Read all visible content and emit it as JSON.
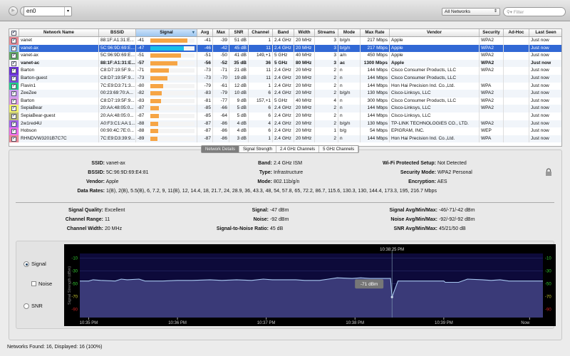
{
  "toolbar": {
    "interface": "en0",
    "network_filter": "All Networks",
    "filter_placeholder": "Filter"
  },
  "table": {
    "columns": [
      "Network Name",
      "BSSID",
      "Signal",
      "Avg",
      "Max",
      "SNR",
      "Channel",
      "Band",
      "Width",
      "Streams",
      "Mode",
      "Max Rate",
      "Vendor",
      "Security",
      "Ad-Hoc",
      "Last Seen"
    ],
    "rows": [
      {
        "color": "#e88a94",
        "name": "vanet",
        "bssid": "88:1F:A1:31:E...",
        "signal": -41,
        "avg": -41,
        "max": -39,
        "snr": "51 dB",
        "channel": "1",
        "band": "2.4 GHz",
        "width": "20 MHz",
        "streams": "3",
        "mode": "b/g/n",
        "rate": "217 Mbps",
        "vendor": "Apple",
        "security": "WPA2",
        "adhoc": "",
        "seen": "Just now"
      },
      {
        "color": "#8fc0f0",
        "name": "vanet-ax",
        "bssid": "5C:96:9D:69:E...",
        "signal": -47,
        "avg": -46,
        "max": -42,
        "snr": "45 dB",
        "channel": "11",
        "band": "2.4 GHz",
        "width": "20 MHz",
        "streams": "3",
        "mode": "b/g/n",
        "rate": "217 Mbps",
        "vendor": "Apple",
        "security": "WPA2",
        "adhoc": "",
        "seen": "Just now",
        "selected": true
      },
      {
        "color": "#62a862",
        "name": "vanet-ax",
        "bssid": "5C:96:9D:69:E...",
        "signal": -51,
        "avg": -51,
        "max": -50,
        "snr": "41 dB",
        "channel": "149,+1",
        "band": "5 GHz",
        "width": "40 MHz",
        "streams": "3",
        "mode": "a/n",
        "rate": "450 Mbps",
        "vendor": "Apple",
        "security": "WPA2",
        "adhoc": "",
        "seen": "Just now"
      },
      {
        "color": "#f4f4fa",
        "name": "vanet-ac",
        "bssid": "88:1F:A1:31:E...",
        "signal": -57,
        "avg": -56,
        "max": -52,
        "snr": "35 dB",
        "channel": "36",
        "band": "5 GHz",
        "width": "80 MHz",
        "streams": "3",
        "mode": "ac",
        "rate": "1300 Mbps",
        "vendor": "Apple",
        "security": "WPA2",
        "adhoc": "",
        "seen": "Just now",
        "bold": true
      },
      {
        "color": "#6a2ed8",
        "name": "Barton",
        "bssid": "C8:D7:19:5F:9...",
        "signal": -71,
        "avg": -73,
        "max": -71,
        "snr": "21 dB",
        "channel": "11",
        "band": "2.4 GHz",
        "width": "20 MHz",
        "streams": "2",
        "mode": "n",
        "rate": "144 Mbps",
        "vendor": "Cisco Consumer Products, LLC",
        "security": "WPA2",
        "adhoc": "",
        "seen": "Just now"
      },
      {
        "color": "#7a4ee0",
        "name": "Barton-guest",
        "bssid": "C8:D7:19:5F:9...",
        "signal": -73,
        "avg": -73,
        "max": -70,
        "snr": "19 dB",
        "channel": "11",
        "band": "2.4 GHz",
        "width": "20 MHz",
        "streams": "2",
        "mode": "n",
        "rate": "144 Mbps",
        "vendor": "Cisco Consumer Products, LLC",
        "security": "",
        "adhoc": "",
        "seen": "Just now"
      },
      {
        "color": "#22d08a",
        "name": "Flavin1",
        "bssid": "7C:E9:D3:71:3...",
        "signal": -80,
        "avg": -79,
        "max": -61,
        "snr": "12 dB",
        "channel": "1",
        "band": "2.4 GHz",
        "width": "20 MHz",
        "streams": "2",
        "mode": "n",
        "rate": "144 Mbps",
        "vendor": "Hon Hai Precision Ind. Co.,Ltd.",
        "security": "WPA",
        "adhoc": "",
        "seen": "Just now"
      },
      {
        "color": "#c8a0ee",
        "name": "ZeeZee",
        "bssid": "00:23:69:70:A...",
        "signal": -82,
        "avg": -83,
        "max": -79,
        "snr": "10 dB",
        "channel": "6",
        "band": "2.4 GHz",
        "width": "20 MHz",
        "streams": "2",
        "mode": "b/g/n",
        "rate": "130 Mbps",
        "vendor": "Cisco-Linksys, LLC",
        "security": "WPA2",
        "adhoc": "",
        "seen": "Just now"
      },
      {
        "color": "#e09ae8",
        "name": "Barton",
        "bssid": "C8:D7:19:5F:9...",
        "signal": -83,
        "avg": -81,
        "max": -77,
        "snr": "9 dB",
        "channel": "157,+1",
        "band": "5 GHz",
        "width": "40 MHz",
        "streams": "4",
        "mode": "n",
        "rate": "300 Mbps",
        "vendor": "Cisco Consumer Products, LLC",
        "security": "WPA2",
        "adhoc": "",
        "seen": "Just now"
      },
      {
        "color": "#eef070",
        "name": "SepiaBear",
        "bssid": "20:AA:48:05:0...",
        "signal": -87,
        "avg": -85,
        "max": -66,
        "snr": "5 dB",
        "channel": "6",
        "band": "2.4 GHz",
        "width": "20 MHz",
        "streams": "2",
        "mode": "n",
        "rate": "144 Mbps",
        "vendor": "Cisco-Linksys, LLC",
        "security": "WPA2",
        "adhoc": "",
        "seen": "Just now"
      },
      {
        "color": "#b8ba78",
        "name": "SepiaBear-guest",
        "bssid": "20:AA:48:05:0...",
        "signal": -87,
        "avg": -85,
        "max": -64,
        "snr": "5 dB",
        "channel": "6",
        "band": "2.4 GHz",
        "width": "20 MHz",
        "streams": "2",
        "mode": "n",
        "rate": "144 Mbps",
        "vendor": "Cisco-Linksys, LLC",
        "security": "",
        "adhoc": "",
        "seen": "Just now"
      },
      {
        "color": "#a266ee",
        "name": "2w1red4U",
        "bssid": "A0:F3:C1:AA:1...",
        "signal": -88,
        "avg": -87,
        "max": -86,
        "snr": "4 dB",
        "channel": "4",
        "band": "2.4 GHz",
        "width": "20 MHz",
        "streams": "2",
        "mode": "b/g/n",
        "rate": "130 Mbps",
        "vendor": "TP-LINK TECHNOLOGIES CO., LTD.",
        "security": "WPA2",
        "adhoc": "",
        "seen": "Just now"
      },
      {
        "color": "#ee70ea",
        "name": "Hobson",
        "bssid": "00:90:4C:7E:0...",
        "signal": -88,
        "avg": -87,
        "max": -86,
        "snr": "4 dB",
        "channel": "6",
        "band": "2.4 GHz",
        "width": "20 MHz",
        "streams": "1",
        "mode": "b/g",
        "rate": "54 Mbps",
        "vendor": "EPIGRAM, INC.",
        "security": "WEP",
        "adhoc": "",
        "seen": "Just now"
      },
      {
        "color": "#e88a94",
        "name": "RHNDVW3201B7C7C",
        "bssid": "7C:E9:D3:39:9...",
        "signal": -89,
        "avg": -87,
        "max": -86,
        "snr": "3 dB",
        "channel": "1",
        "band": "2.4 GHz",
        "width": "20 MHz",
        "streams": "2",
        "mode": "n",
        "rate": "144 Mbps",
        "vendor": "Hon Hai Precision Ind. Co.,Ltd.",
        "security": "WPA",
        "adhoc": "",
        "seen": "Just now"
      }
    ]
  },
  "tabs": [
    "Network Details",
    "Signal Strength",
    "2.4 GHz Channels",
    "5 GHz Channels"
  ],
  "details": {
    "ssid": {
      "label": "SSID:",
      "value": "vanet-ax"
    },
    "bssid": {
      "label": "BSSID:",
      "value": "5C:96:9D:69:E4:81"
    },
    "vendor": {
      "label": "Vendor:",
      "value": "Apple"
    },
    "band": {
      "label": "Band:",
      "value": "2.4 GHz ISM"
    },
    "type": {
      "label": "Type:",
      "value": "Infrastructure"
    },
    "mode": {
      "label": "Mode:",
      "value": "802.11b/g/n"
    },
    "wps": {
      "label": "Wi-Fi Protected Setup:",
      "value": "Not Detected"
    },
    "security": {
      "label": "Security Mode:",
      "value": "WPA2 Personal"
    },
    "encryption": {
      "label": "Encryption:",
      "value": "AES"
    },
    "rates": {
      "label": "Data Rates:",
      "value": "1(B), 2(B), 5.5(B), 6, 7.2, 9, 11(B), 12, 14.4, 18, 21.7, 24, 28.9, 36, 43.3, 48, 54, 57.8, 65, 72.2, 86.7, 115.6, 130.3, 130, 144.4, 173.3, 195, 216.7 Mbps"
    },
    "quality": {
      "label": "Signal Quality:",
      "value": "Excellent"
    },
    "range": {
      "label": "Channel Range:",
      "value": "11"
    },
    "chwidth": {
      "label": "Channel Width:",
      "value": "20 MHz"
    },
    "signal": {
      "label": "Signal:",
      "value": "-47 dBm"
    },
    "noise": {
      "label": "Noise:",
      "value": "-92 dBm"
    },
    "snr": {
      "label": "Signal-to-Noise Ratio:",
      "value": "45 dB"
    },
    "sigamm": {
      "label": "Signal Avg/Min/Max:",
      "value": "-46/-71/-42 dBm"
    },
    "noiseamm": {
      "label": "Noise Avg/Min/Max:",
      "value": "-92/-92/-92 dBm"
    },
    "snramm": {
      "label": "SNR Avg/Min/Max:",
      "value": "45/21/50 dB"
    }
  },
  "graph_options": {
    "signal": "Signal",
    "noise": "Noise",
    "snr": "SNR"
  },
  "chart_data": {
    "type": "line",
    "ylabel": "Signal Strength (dBm)",
    "ylim": [
      -103,
      -3
    ],
    "yticks": [
      "-10",
      "-30",
      "-50",
      "-70",
      "-90"
    ],
    "ytick_values": [
      -10,
      -30,
      -50,
      -70,
      -90
    ],
    "xlim_seconds": [
      -6,
      307
    ],
    "xticks": [
      "10:35 PM",
      "10:36 PM",
      "10:37 PM",
      "10:38 PM",
      "10:39 PM",
      "Now"
    ],
    "xtick_seconds": [
      0,
      60,
      120,
      180,
      240,
      298
    ],
    "cursor_label": "10:38:25 PM",
    "cursor_seconds": 205,
    "tooltip": "-71 dBm",
    "series": [
      {
        "name": "Signal",
        "points": [
          [
            -6,
            -46
          ],
          [
            0,
            -46
          ],
          [
            3,
            -44
          ],
          [
            8,
            -45
          ],
          [
            18,
            -46
          ],
          [
            22,
            -43
          ],
          [
            26,
            -44
          ],
          [
            34,
            -43
          ],
          [
            38,
            -46
          ],
          [
            50,
            -46
          ],
          [
            60,
            -45
          ],
          [
            70,
            -45
          ],
          [
            82,
            -44
          ],
          [
            90,
            -45
          ],
          [
            100,
            -44
          ],
          [
            110,
            -45
          ],
          [
            118,
            -43
          ],
          [
            124,
            -44
          ],
          [
            140,
            -44
          ],
          [
            146,
            -45
          ],
          [
            156,
            -45
          ],
          [
            162,
            -43
          ],
          [
            168,
            -41
          ],
          [
            178,
            -42
          ],
          [
            184,
            -41
          ],
          [
            190,
            -42
          ],
          [
            204,
            -42
          ],
          [
            205,
            -71
          ],
          [
            209,
            -46
          ],
          [
            240,
            -46
          ],
          [
            241,
            -48
          ],
          [
            250,
            -48
          ],
          [
            256,
            -43
          ],
          [
            266,
            -44
          ],
          [
            272,
            -45
          ],
          [
            278,
            -44
          ],
          [
            284,
            -46
          ],
          [
            307,
            -46
          ]
        ]
      }
    ]
  },
  "status": "Networks Found: 16, Displayed: 16 (100%)"
}
